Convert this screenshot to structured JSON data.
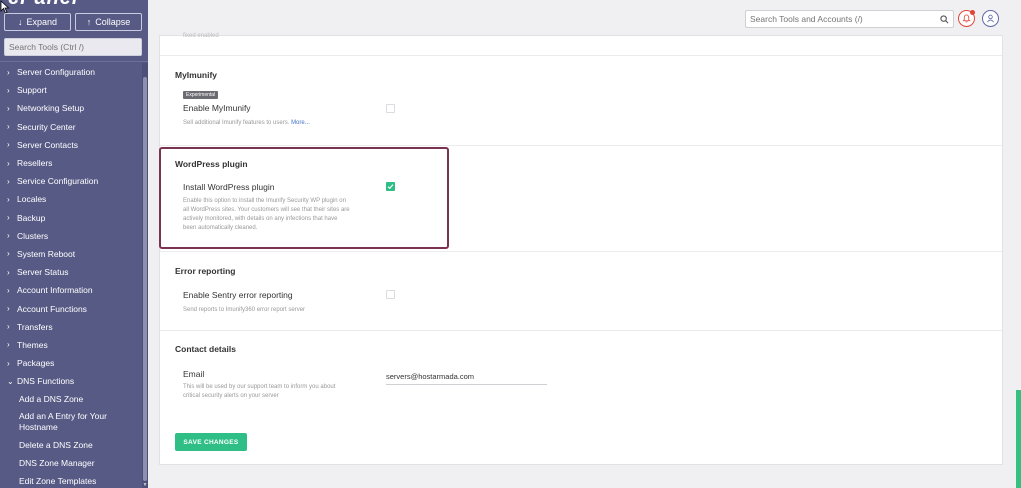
{
  "sidebar": {
    "logo_text": "cPanel",
    "expand_label": "Expand",
    "collapse_label": "Collapse",
    "search_placeholder": "Search Tools (Ctrl /)",
    "items": [
      {
        "label": "Server Configuration"
      },
      {
        "label": "Support"
      },
      {
        "label": "Networking Setup"
      },
      {
        "label": "Security Center"
      },
      {
        "label": "Server Contacts"
      },
      {
        "label": "Resellers"
      },
      {
        "label": "Service Configuration"
      },
      {
        "label": "Locales"
      },
      {
        "label": "Backup"
      },
      {
        "label": "Clusters"
      },
      {
        "label": "System Reboot"
      },
      {
        "label": "Server Status"
      },
      {
        "label": "Account Information"
      },
      {
        "label": "Account Functions"
      },
      {
        "label": "Transfers"
      },
      {
        "label": "Themes"
      },
      {
        "label": "Packages"
      },
      {
        "label": "DNS Functions"
      }
    ],
    "sub_items": [
      {
        "label": "Add a DNS Zone"
      },
      {
        "label": "Add an A Entry for Your Hostname"
      },
      {
        "label": "Delete a DNS Zone"
      },
      {
        "label": "DNS Zone Manager"
      },
      {
        "label": "Edit Zone Templates"
      }
    ]
  },
  "topbar": {
    "search_placeholder": "Search Tools and Accounts (/)"
  },
  "content": {
    "top_cut_text": "fixed enabled",
    "myimunify": {
      "title": "MyImunify",
      "badge": "Experimental",
      "option_label": "Enable MyImunify",
      "description": "Sell additional Imunify features to users.",
      "more_link": "More...",
      "checked": false
    },
    "wordpress": {
      "title": "WordPress plugin",
      "option_label": "Install WordPress plugin",
      "description_lines": [
        "Enable this option to install the Imunify Security WP plugin on",
        "all WordPress sites. Your customers will see that their sites are",
        "actively monitored, with details on any infections that have",
        "been automatically cleaned."
      ],
      "checked": true
    },
    "error_reporting": {
      "title": "Error reporting",
      "option_label": "Enable Sentry error reporting",
      "description": "Send reports to Imunify360 error report server",
      "checked": false
    },
    "contact": {
      "title": "Contact details",
      "email_label": "Email",
      "description_lines": [
        "This will be used by our support team to inform you about",
        "critical security alerts on your server"
      ],
      "email_value": "servers@hostarmada.com"
    },
    "save_label": "SAVE CHANGES"
  },
  "colors": {
    "sidebar_bg": "#575a85",
    "accent_green": "#2fbf86",
    "highlight_border": "#7a3350",
    "alert_red": "#e0453a"
  }
}
